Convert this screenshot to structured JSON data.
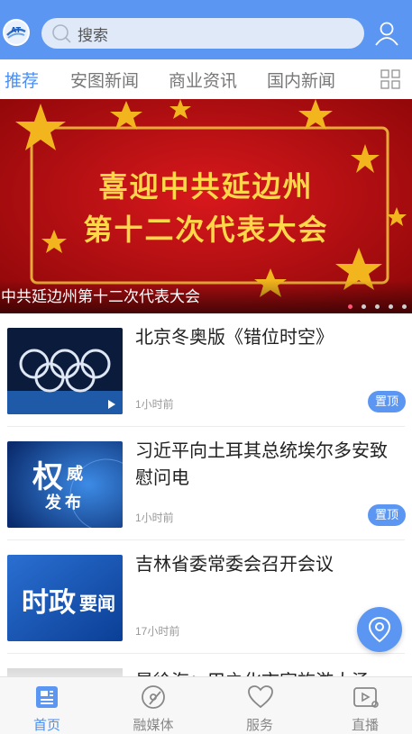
{
  "header": {
    "search_placeholder": "搜索",
    "logo_icon": "app-logo",
    "user_icon": "user-icon"
  },
  "tabs": [
    {
      "label": "推荐",
      "active": true
    },
    {
      "label": "安图新闻"
    },
    {
      "label": "商业资讯"
    },
    {
      "label": "国内新闻"
    }
  ],
  "banner": {
    "headline_line1": "喜迎中共延边州",
    "headline_line2": "第十二次代表大会",
    "caption": "中共延边州第十二次代表大会",
    "slide_count": 5,
    "active_slide": 1
  },
  "news": [
    {
      "title": "北京冬奥版《错位时空》",
      "time": "1小时前",
      "pinned_label": "置顶",
      "thumb": "olympic-rings-video"
    },
    {
      "title": "习近平向土耳其总统埃尔多安致慰问电",
      "time": "1小时前",
      "pinned_label": "置顶",
      "thumb": "authoritative-release",
      "thumb_text_1": "权",
      "thumb_text_2": "威",
      "thumb_text_3": "发布"
    },
    {
      "title": "吉林省委常委会召开会议",
      "time": "17小时前",
      "thumb": "political-news",
      "thumb_text_1": "时政",
      "thumb_text_2": "要闻"
    },
    {
      "title": "是徐海：甲之化市家旅游大汤"
    }
  ],
  "bottom_nav": [
    {
      "label": "首页",
      "icon": "home-news-icon",
      "active": true
    },
    {
      "label": "融媒体",
      "icon": "media-disc-icon"
    },
    {
      "label": "服务",
      "icon": "heart-icon"
    },
    {
      "label": "直播",
      "icon": "live-tv-icon"
    }
  ],
  "colors": {
    "primary": "#5b97f2",
    "banner_red": "#b30d10",
    "banner_gold": "#ffd84a"
  }
}
